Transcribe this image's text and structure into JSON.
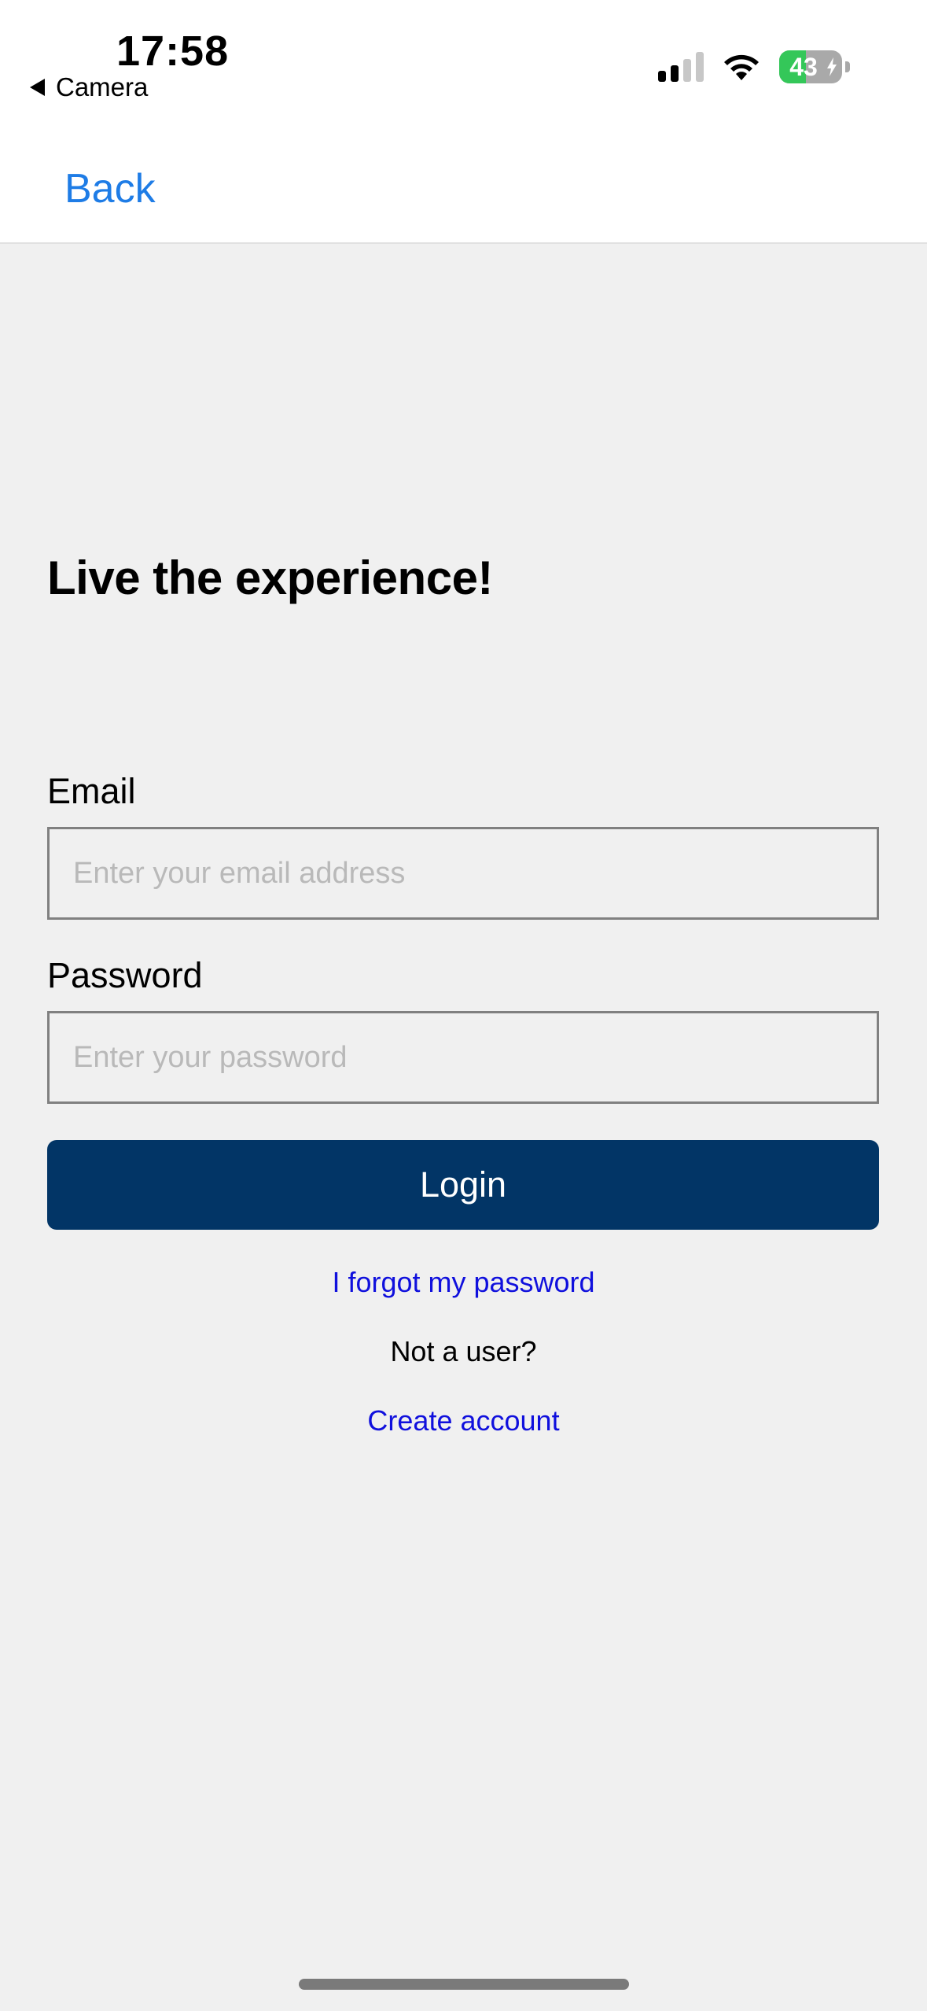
{
  "status_bar": {
    "time": "17:58",
    "back_app": "Camera",
    "battery_level": "43",
    "battery_fraction": 0.43,
    "signal_bars_active": 2,
    "signal_bars_total": 4,
    "icons": [
      "back-arrow-icon",
      "cellular-signal-icon",
      "wifi-icon",
      "battery-charging-icon"
    ]
  },
  "nav": {
    "back_label": "Back"
  },
  "main": {
    "headline": "Live the experience!",
    "email": {
      "label": "Email",
      "value": "",
      "placeholder": "Enter your email address"
    },
    "password": {
      "label": "Password",
      "value": "",
      "placeholder": "Enter your password"
    },
    "login_label": "Login",
    "forgot_password": "I forgot my password",
    "not_a_user": "Not a user?",
    "create_account": "Create account"
  },
  "colors": {
    "nav_link": "#1e7ce6",
    "login_button": "#023566",
    "text_link": "#1010dd",
    "background": "#f0f0f0",
    "battery_green": "#34c759"
  }
}
